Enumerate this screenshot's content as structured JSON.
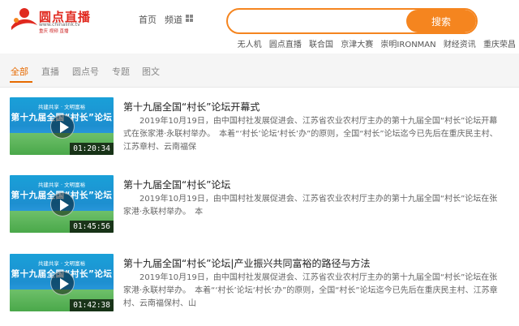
{
  "header": {
    "logo_title": "圆点直播",
    "logo_url": "www.chinalink.tv",
    "logo_sub": "重庆  视频  直播",
    "nav": [
      "首页",
      "频道"
    ],
    "search": {
      "placeholder": "",
      "value": "",
      "button": "搜索"
    },
    "hot_links": [
      "无人机",
      "圆点直播",
      "联合国",
      "京津大赛",
      "崇明IRONMAN",
      "财经资讯",
      "重庆荣昌"
    ]
  },
  "tabs": {
    "active": 0,
    "items": [
      "全部",
      "直播",
      "圆点号",
      "专题",
      "图文"
    ]
  },
  "thumb_slogan": "共建共享 · 文明富裕",
  "thumb_title": "第十九届全国“村长”论坛",
  "results": [
    {
      "title": "第十九届全国“村长”论坛开幕式",
      "desc": "2019年10月19日，由中国村社发展促进会、江苏省农业农村厅主办的第十九届全国“村长”论坛开幕式在张家港·永联村举办。　本着“‘村长’论坛‘村长’办”的原则，全国“村长”论坛迄今已先后在重庆民主村、江苏章村、云南福保",
      "duration": "01:20:34"
    },
    {
      "title": "第十九届全国“村长”论坛",
      "desc": "2019年10月19日，由中国村社发展促进会、江苏省农业农村厅主办的第十九届全国“村长”论坛在张家港·永联村举办。　本",
      "duration": "01:45:56"
    },
    {
      "title": "第十九届全国“村长”论坛|产业振兴共同富裕的路径与方法",
      "desc": "2019年10月19日，由中国村社发展促进会、江苏省农业农村厅主办的第十九届全国“村长”论坛在张家港·永联村举办。　本着“‘村长’论坛‘村长’办”的原则，全国“村长”论坛迄今已先后在重庆民主村、江苏章村、云南福保村、山",
      "duration": "01:42:38"
    }
  ],
  "colors": {
    "accent": "#f5851f",
    "active_tab": "#e66a00",
    "brand_red": "#e0281e"
  }
}
